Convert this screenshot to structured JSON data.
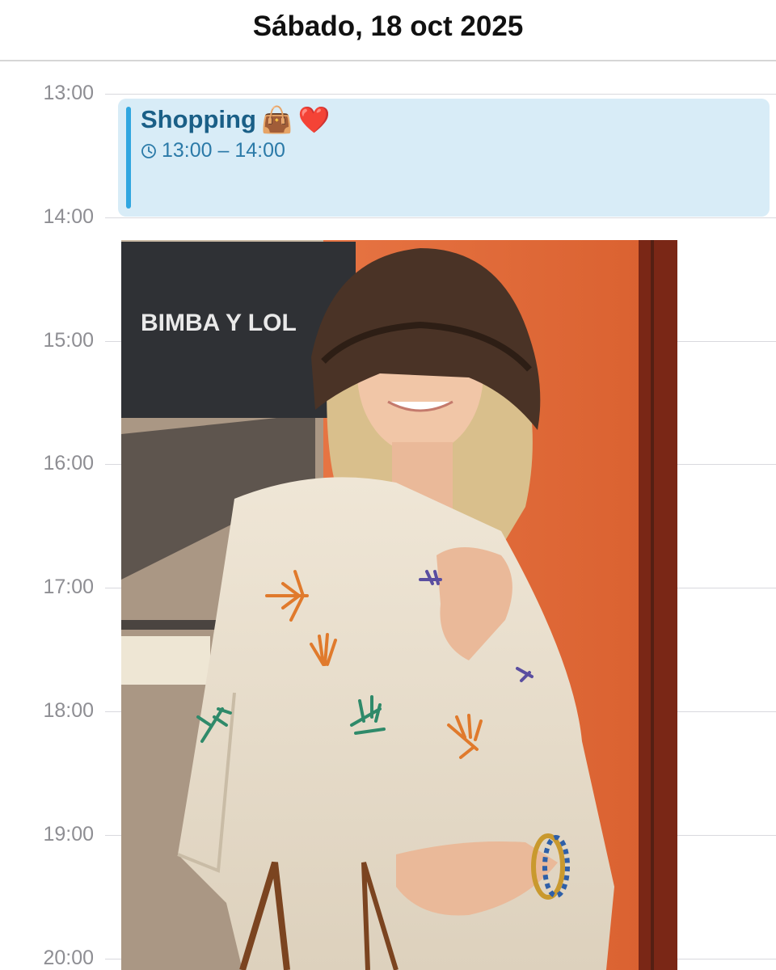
{
  "header": {
    "date_title": "Sábado, 18 oct 2025"
  },
  "timeline": {
    "hours": [
      "13:00",
      "14:00",
      "15:00",
      "16:00",
      "17:00",
      "18:00",
      "19:00",
      "20:00"
    ]
  },
  "event": {
    "title": "Shopping",
    "emoji_bag": "👜",
    "emoji_heart": "❤️",
    "time_range": "13:00 – 14:00",
    "accent_color": "#2fa6e0",
    "background_color": "#d8ecf7"
  },
  "photo": {
    "store_sign_text": "BIMBA Y LOL"
  },
  "icons": {
    "clock": "clock-icon"
  }
}
